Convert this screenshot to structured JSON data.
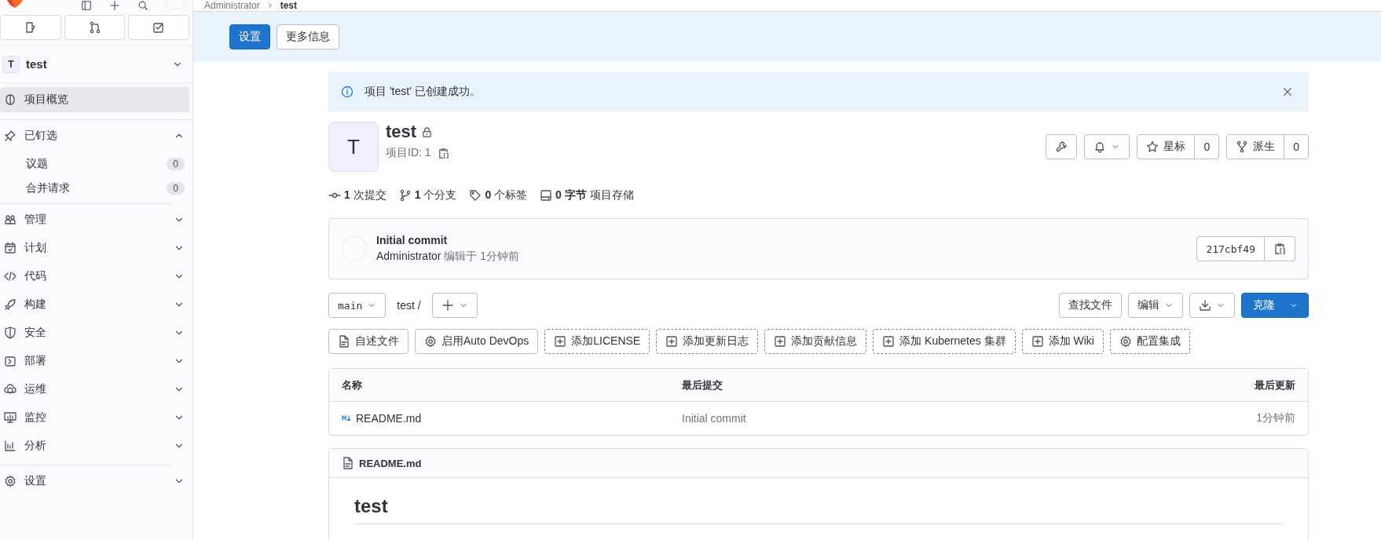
{
  "topbar": {
    "breadcrumb": [
      "Administrator",
      "test"
    ]
  },
  "sidebar": {
    "project": {
      "avatar": "T",
      "name": "test"
    },
    "sections": [
      [
        {
          "label": "项目概览",
          "selected": true
        }
      ],
      [
        {
          "label": "已钉选",
          "selected": false,
          "expanded": true,
          "children": [
            {
              "label": "议题",
              "count": "0",
              "selected": false
            },
            {
              "label": "合并请求",
              "count": "0",
              "selected": false
            }
          ]
        }
      ],
      [
        {
          "label": "管理",
          "selected": false,
          "expanded": false
        },
        {
          "label": "计划",
          "selected": false,
          "expanded": false
        },
        {
          "label": "代码",
          "selected": false,
          "expanded": false
        },
        {
          "label": "构建",
          "selected": false,
          "expanded": false
        },
        {
          "label": "安全",
          "selected": false,
          "expanded": false
        },
        {
          "label": "部署",
          "selected": false,
          "expanded": false
        },
        {
          "label": "运维",
          "selected": false,
          "expanded": false
        },
        {
          "label": "监控",
          "selected": false,
          "expanded": false
        },
        {
          "label": "分析",
          "selected": false,
          "expanded": false
        }
      ],
      [
        {
          "label": "设置",
          "selected": false,
          "expanded": false
        }
      ]
    ]
  },
  "banner": {
    "buttons": [
      {
        "label": "设置",
        "primary": true
      },
      {
        "label": "更多信息",
        "primary": false
      }
    ]
  },
  "alert": {
    "message": "项目 'test' 已创建成功。"
  },
  "project_header": {
    "avatar": "T",
    "name": "test",
    "project_id": "项目ID: 1",
    "counters": [
      {
        "kind": "star",
        "label": "星标",
        "count": "0"
      },
      {
        "kind": "fork",
        "label": "派生",
        "count": "0"
      }
    ]
  },
  "stats": [
    {
      "kind": "commit",
      "text": "**1** 次提交"
    },
    {
      "kind": "branch",
      "text": "**1** 个分支"
    },
    {
      "kind": "tag",
      "text": "**0** 个标签"
    },
    {
      "kind": "storage",
      "text": "**0 字节** 项目存储"
    }
  ],
  "last_commit": {
    "title": "Initial commit",
    "author": "Administrator",
    "meta": "编辑于 1分钟前",
    "sha": "217cbf49"
  },
  "repo_nav": {
    "branch": "main",
    "path": "test",
    "separator": "/",
    "find_file": "查找文件",
    "edit": "编辑",
    "clone": "克隆"
  },
  "shortcuts": [
    {
      "kind": "file",
      "label": "自述文件",
      "dashed": false
    },
    {
      "kind": "settings",
      "label": "启用Auto DevOps",
      "dashed": false
    },
    {
      "kind": "add",
      "label": "添加LICENSE",
      "dashed": true
    },
    {
      "kind": "add",
      "label": "添加更新日志",
      "dashed": true
    },
    {
      "kind": "add",
      "label": "添加贡献信息",
      "dashed": true
    },
    {
      "kind": "add",
      "label": "添加 Kubernetes 集群",
      "dashed": true
    },
    {
      "kind": "add",
      "label": "添加 Wiki",
      "dashed": true
    },
    {
      "kind": "settings",
      "label": "配置集成",
      "dashed": true
    }
  ],
  "file_table": {
    "columns": [
      "名称",
      "最后提交",
      "最后更新"
    ],
    "rows": [
      {
        "name": "README.md",
        "commit": "Initial commit",
        "updated": "1分钟前"
      }
    ]
  },
  "readme": {
    "filename": "README.md",
    "heading": "test"
  }
}
